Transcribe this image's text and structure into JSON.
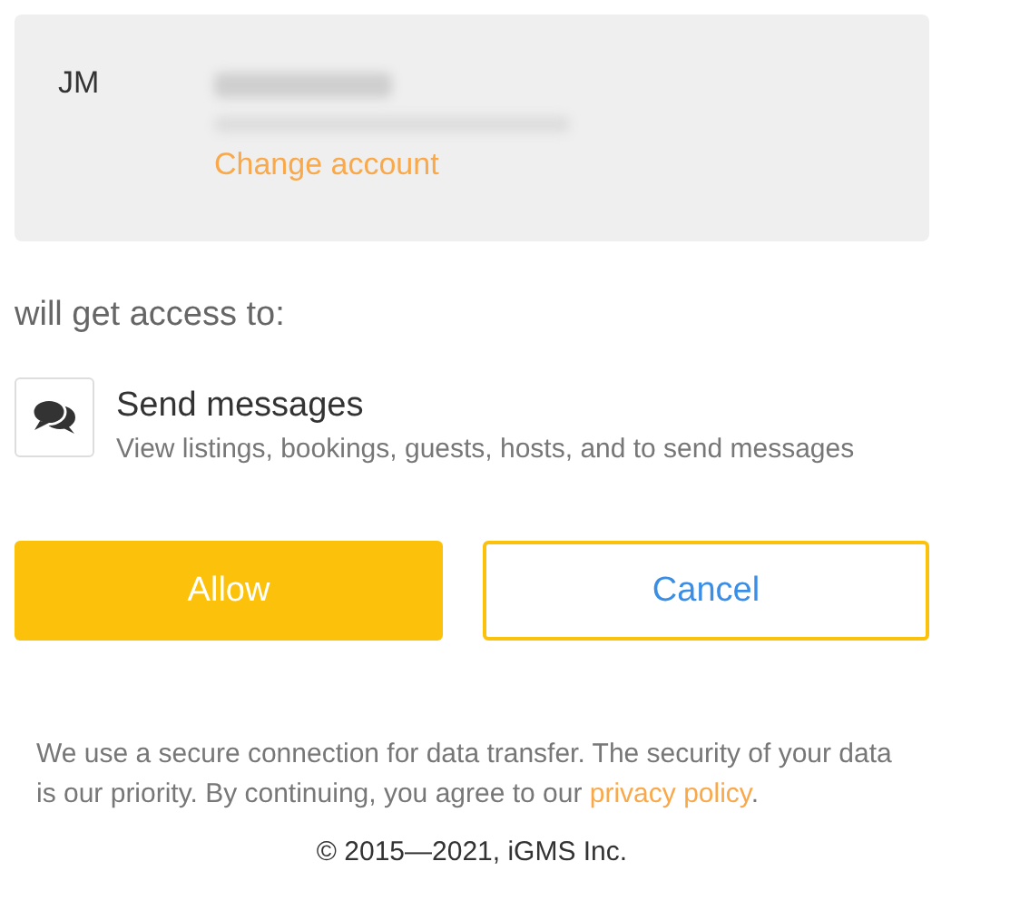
{
  "account": {
    "initials": "JM",
    "change_link": "Change account"
  },
  "access_heading": "will get access to:",
  "permissions": [
    {
      "title": "Send messages",
      "description": "View listings, bookings, guests, hosts, and to send messages"
    }
  ],
  "buttons": [
    {
      "label": "Allow",
      "kind": "primary"
    },
    {
      "label": "Cancel",
      "kind": "secondary"
    }
  ],
  "footer": {
    "notice": "We use a secure connection for data transfer. The security of your data is our priority. By continuing, you agree to our",
    "link": "privacy policy",
    "end": ".",
    "copyright": "© 2015—2021, iGMS Inc."
  }
}
